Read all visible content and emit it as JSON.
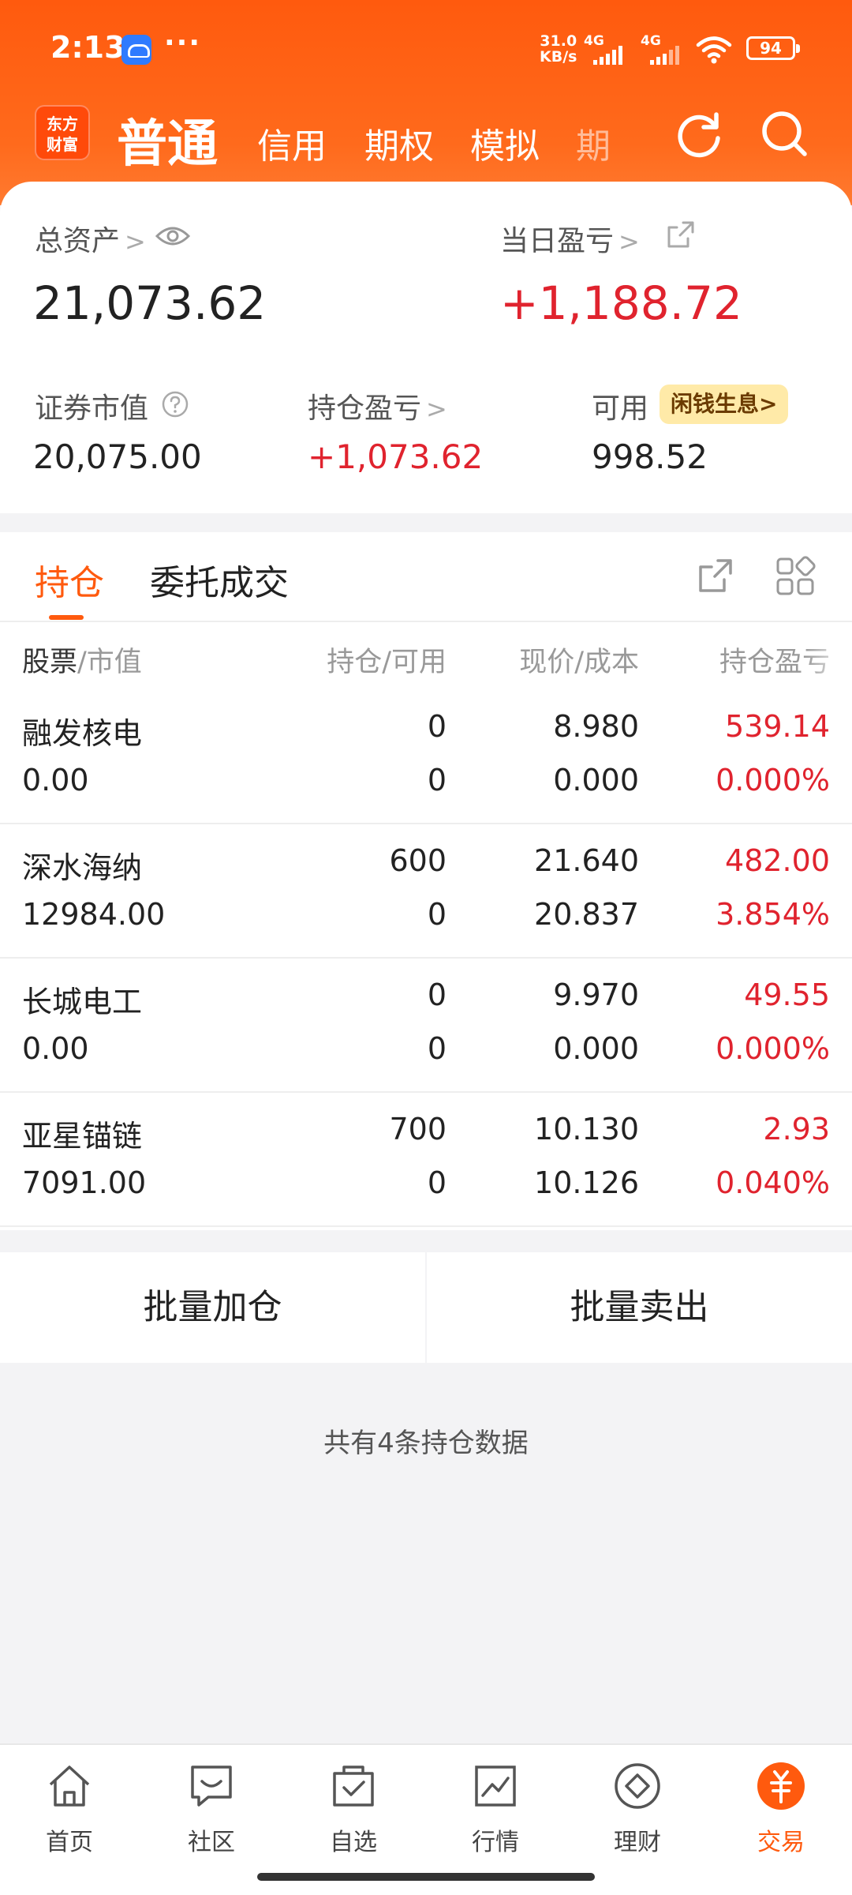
{
  "status_bar": {
    "time": "2:13",
    "more": "···",
    "speed_value": "31.0",
    "speed_unit": "KB/s",
    "sim1": "4G",
    "sim2": "4G",
    "battery": "94"
  },
  "header": {
    "logo_line1": "东方",
    "logo_line2": "财富",
    "tabs": [
      "普通",
      "信用",
      "期权",
      "模拟",
      "期"
    ],
    "active_tab": "普通"
  },
  "assets": {
    "total_label": "总资产",
    "total_value": "21,073.62",
    "daily_pnl_label": "当日盈亏",
    "daily_pnl_value": "+1,188.72",
    "market_value_label": "证券市值",
    "market_value": "20,075.00",
    "position_pnl_label": "持仓盈亏",
    "position_pnl_value": "+1,073.62",
    "available_label": "可用",
    "available_value": "998.52",
    "promo_label": "闲钱生息>"
  },
  "positions_tabs": {
    "holdings": "持仓",
    "orders": "委托成交"
  },
  "table": {
    "headers": {
      "stock": "股票",
      "market_value": "/市值",
      "qty": "持仓/可用",
      "price": "现价/成本",
      "pnl": "持仓盈亏"
    },
    "rows": [
      {
        "name": "融发核电",
        "market_value": "0.00",
        "qty": "0",
        "available": "0",
        "price": "8.980",
        "cost": "0.000",
        "pnl": "539.14",
        "pnl_pct": "0.000%"
      },
      {
        "name": "深水海纳",
        "market_value": "12984.00",
        "qty": "600",
        "available": "0",
        "price": "21.640",
        "cost": "20.837",
        "pnl": "482.00",
        "pnl_pct": "3.854%"
      },
      {
        "name": "长城电工",
        "market_value": "0.00",
        "qty": "0",
        "available": "0",
        "price": "9.970",
        "cost": "0.000",
        "pnl": "49.55",
        "pnl_pct": "0.000%"
      },
      {
        "name": "亚星锚链",
        "market_value": "7091.00",
        "qty": "700",
        "available": "0",
        "price": "10.130",
        "cost": "10.126",
        "pnl": "2.93",
        "pnl_pct": "0.040%"
      }
    ]
  },
  "actions": {
    "batch_add": "批量加仓",
    "batch_sell": "批量卖出"
  },
  "summary": "共有4条持仓数据",
  "bottom_nav": [
    {
      "label": "首页",
      "icon": "home-icon"
    },
    {
      "label": "社区",
      "icon": "chat-icon"
    },
    {
      "label": "自选",
      "icon": "watchlist-icon"
    },
    {
      "label": "行情",
      "icon": "chart-icon"
    },
    {
      "label": "理财",
      "icon": "diamond-icon"
    },
    {
      "label": "交易",
      "icon": "trade-icon",
      "active": true
    }
  ],
  "colors": {
    "brand_orange": "#ff5a0e",
    "profit_red": "#e0232e",
    "promo_bg": "#ffeaa8"
  }
}
